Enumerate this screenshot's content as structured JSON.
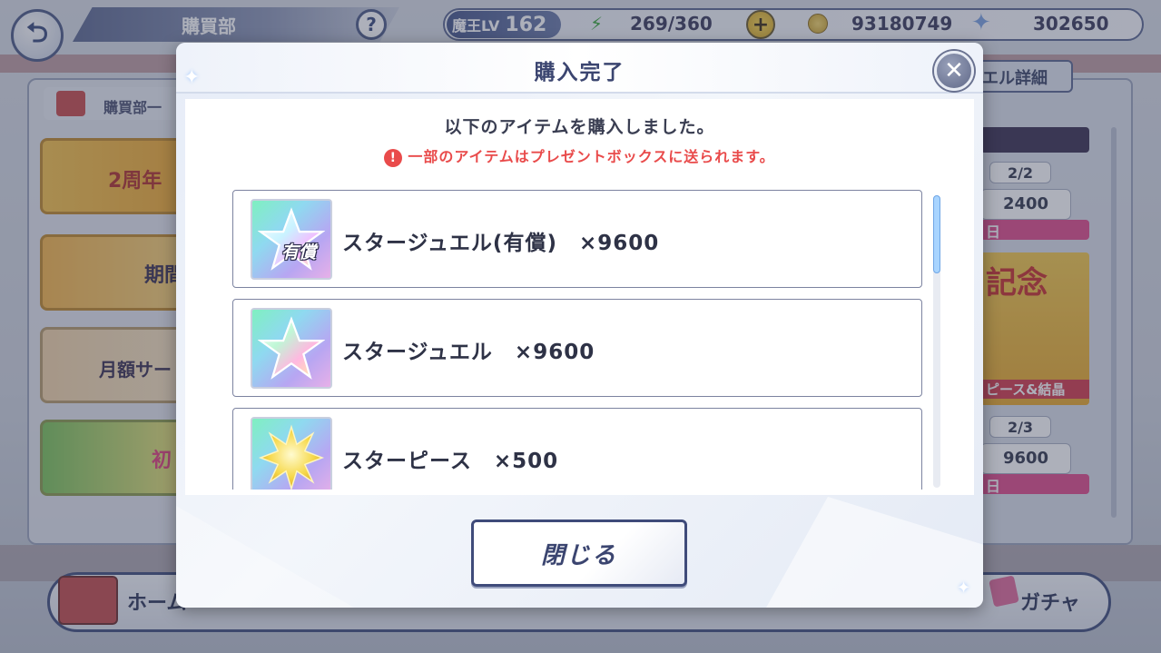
{
  "screen": {
    "title": "購買部",
    "help": "?",
    "back": "⮌"
  },
  "status": {
    "level_label": "魔王LV",
    "level": "162",
    "stamina": "269/360",
    "plus": "+",
    "coins": "93180749",
    "jewels": "302650"
  },
  "left_panel": {
    "header": "購買部一",
    "banners": [
      {
        "label": "2周年"
      },
      {
        "label": "期間"
      },
      {
        "label": "月額サー"
      },
      {
        "label": "初"
      }
    ]
  },
  "right_panel": {
    "tab": "エル詳細",
    "cards": [
      {
        "count": "2/2",
        "price": "2400",
        "tag": "日"
      },
      {
        "count": "2/3",
        "price": "9600",
        "tag": "日"
      }
    ],
    "banner_text": "ピース&結晶",
    "banner_title": "記念"
  },
  "bottom_nav": {
    "home": "ホーム",
    "gacha": "ガチャ"
  },
  "modal": {
    "title": "購入完了",
    "message": "以下のアイテムを購入しました。",
    "note": "一部のアイテムはプレゼントボックスに送られます。",
    "note_icon": "!",
    "close_icon": "✕",
    "close_button": "閉じる",
    "items": [
      {
        "name": "スタージュエル(有償)　×9600",
        "icon": "star-jewel-paid-icon",
        "tag": "有償"
      },
      {
        "name": "スタージュエル　×9600",
        "icon": "star-jewel-icon"
      },
      {
        "name": "スターピース　×500",
        "icon": "star-piece-icon"
      }
    ]
  },
  "colors": {
    "accent_navy": "#3b4570",
    "warning_red": "#e94b4b",
    "gold": "#f8d64e"
  }
}
